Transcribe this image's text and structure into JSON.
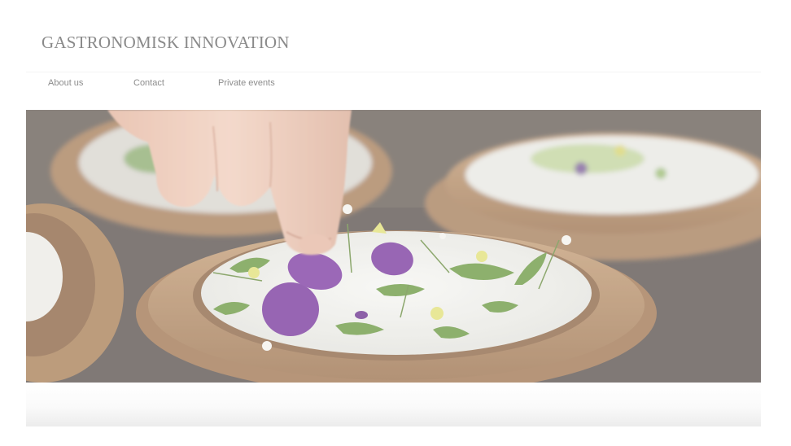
{
  "brand": {
    "name": "GASTRONOMISK INNOVATION"
  },
  "nav": {
    "items": [
      {
        "label": "About us"
      },
      {
        "label": "Contact"
      },
      {
        "label": "Private events"
      }
    ]
  },
  "hero": {
    "image": "hand placing edible flower petals on plated dish",
    "colors": {
      "table": "#5a504c",
      "plate_rim": "#b0875f",
      "plate_surface": "#eeeeea",
      "petal": "#7a3a9e",
      "herb": "#5f8a3c",
      "skin": "#ecc4b0"
    }
  }
}
